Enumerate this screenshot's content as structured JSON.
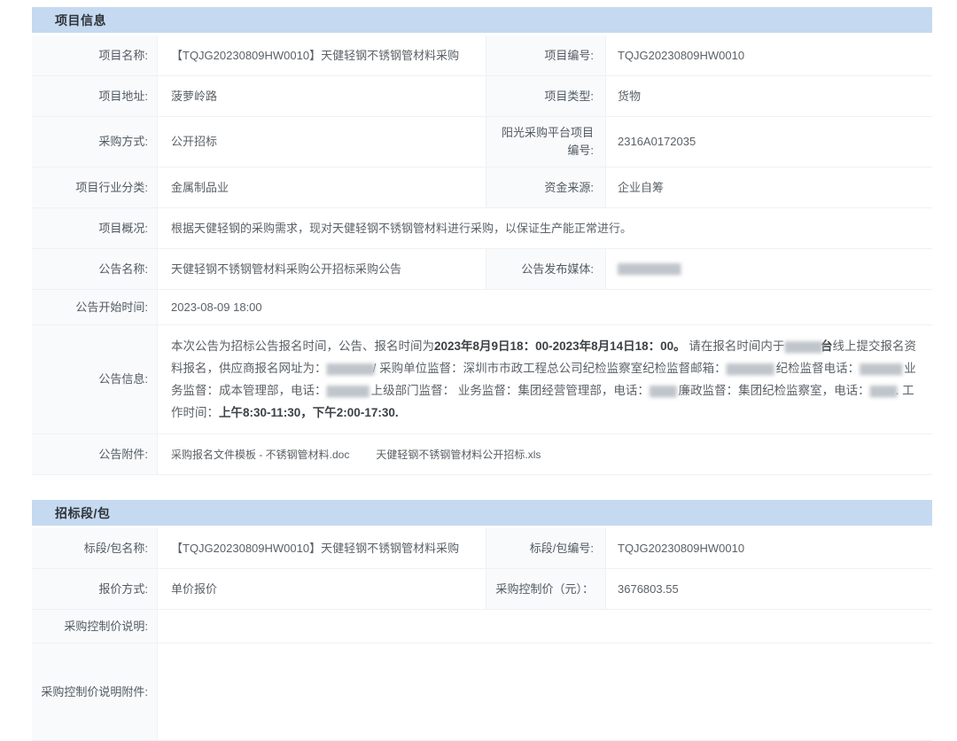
{
  "colors": {
    "header_bg": "#c5d9f1",
    "label_bg": "#f8fafb",
    "border": "#eff1f3",
    "label_text": "#525a62",
    "value_text": "#5b6167"
  },
  "section1": {
    "title": "项目信息",
    "rows": {
      "project_name": {
        "label": "项目名称:",
        "value": "【TQJG20230809HW0010】天健轻钢不锈钢管材料采购"
      },
      "project_no": {
        "label": "项目编号:",
        "value": "TQJG20230809HW0010"
      },
      "project_addr": {
        "label": "项目地址:",
        "value": "菠萝岭路"
      },
      "project_type": {
        "label": "项目类型:",
        "value": "货物"
      },
      "purchase_method": {
        "label": "采购方式:",
        "value": "公开招标"
      },
      "platform_no": {
        "label": "阳光采购平台项目编号:",
        "value": "2316A0172035"
      },
      "industry": {
        "label": "项目行业分类:",
        "value": "金属制品业"
      },
      "fund_source": {
        "label": "资金来源:",
        "value": "企业自筹"
      },
      "overview": {
        "label": "项目概况:",
        "value": "根据天健轻钢的采购需求，现对天健轻钢不锈钢管材料进行采购，以保证生产能正常进行。"
      },
      "notice_name": {
        "label": "公告名称:",
        "value": "天健轻钢不锈钢管材料采购公开招标采购公告"
      },
      "notice_media": {
        "label": "公告发布媒体:",
        "value": "████████████"
      },
      "notice_start": {
        "label": "公告开始时间:",
        "value": "2023-08-09 18:00"
      },
      "notice_info": {
        "label": "公告信息:",
        "segments": [
          {
            "t": "本次公告为招标公告报名时间，公告、报名时间为"
          },
          {
            "t": "2023年8月9日18：00-2023年8月14日18：00。",
            "b": true
          },
          {
            "t": " 请在报名时间内于"
          },
          {
            "t": "███████",
            "r": true
          },
          {
            "t": "台",
            "b": true
          },
          {
            "t": "线上提交报名资料报名，供应商报名网址为："
          },
          {
            "t": "█████████",
            "r": true
          },
          {
            "t": "/ 采购单位监督：深圳市市政工程总公司纪检监察室纪检监督邮箱："
          },
          {
            "t": "█████████",
            "r": true
          },
          {
            "t": " 纪检监督电话："
          },
          {
            "t": "████████",
            "r": true
          },
          {
            "t": " 业务监督：成本管理部，电话："
          },
          {
            "t": "████████",
            "r": true
          },
          {
            "t": " 上级部门监督： 业务监督：集团经营管理部，电话："
          },
          {
            "t": "█████",
            "r": true
          },
          {
            "t": " 廉政监督：集团纪检监察室，电话："
          },
          {
            "t": "█████",
            "r": true
          },
          {
            "t": ". 工作时间："
          },
          {
            "t": "上午8:30-11:30，下午2:00-17:30.",
            "b": true
          }
        ]
      },
      "attachments": {
        "label": "公告附件:",
        "files": [
          "采购报名文件模板 - 不锈钢管材料.doc",
          "天健轻钢不锈钢管材料公开招标.xls"
        ]
      }
    }
  },
  "section2": {
    "title": "招标段/包",
    "rows": {
      "package_name": {
        "label": "标段/包名称:",
        "value": "【TQJG20230809HW0010】天健轻钢不锈钢管材料采购"
      },
      "package_no": {
        "label": "标段/包编号:",
        "value": "TQJG20230809HW0010"
      },
      "quote_method": {
        "label": "报价方式:",
        "value": "单价报价"
      },
      "control_price": {
        "label": "采购控制价（元）：",
        "value": "3676803.55"
      },
      "control_price_note": {
        "label": "采购控制价说明:",
        "value": ""
      },
      "control_price_attach": {
        "label": "采购控制价说明附件:",
        "value": ""
      }
    }
  }
}
